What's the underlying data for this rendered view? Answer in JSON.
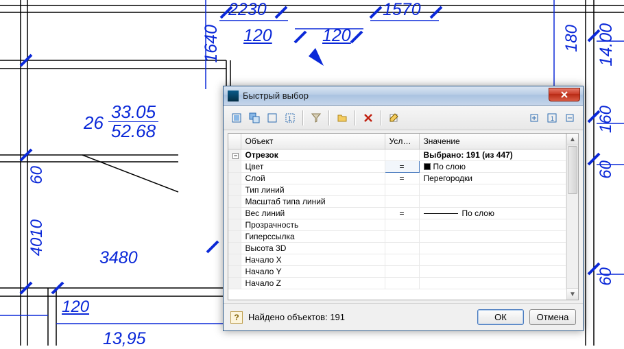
{
  "dialog": {
    "title": "Быстрый выбор",
    "columns": {
      "object": "Объект",
      "cond": "Услов...",
      "value": "Значение"
    },
    "group": {
      "name": "Отрезок",
      "summary": "Выбрано: 191 (из 447)"
    },
    "rows": [
      {
        "prop": "Цвет",
        "cond": "=",
        "value": "По слою",
        "swatch": true
      },
      {
        "prop": "Слой",
        "cond": "=",
        "value": "Перегородки"
      },
      {
        "prop": "Тип линий",
        "cond": "",
        "value": ""
      },
      {
        "prop": "Масштаб типа линий",
        "cond": "",
        "value": ""
      },
      {
        "prop": "Вес линий",
        "cond": "=",
        "value": "По слою",
        "line": true
      },
      {
        "prop": "Прозрачность",
        "cond": "",
        "value": ""
      },
      {
        "prop": "Гиперссылка",
        "cond": "",
        "value": ""
      },
      {
        "prop": "Высота 3D",
        "cond": "",
        "value": ""
      },
      {
        "prop": "Начало X",
        "cond": "",
        "value": ""
      },
      {
        "prop": "Начало Y",
        "cond": "",
        "value": ""
      },
      {
        "prop": "Начало Z",
        "cond": "",
        "value": ""
      }
    ],
    "status": "Найдено объектов: 191",
    "ok": "ОК",
    "cancel": "Отмена"
  },
  "cad": {
    "dims": {
      "d2230": "2230",
      "d1570": "1570",
      "d120a": "120",
      "d120b": "120",
      "d1640": "1640",
      "d26": "26",
      "d3305": "33.05",
      "d5268": "52.68",
      "d60a": "60",
      "d4010": "4010",
      "d3480": "3480",
      "d120c": "120",
      "d1395": "13,95",
      "d180": "180",
      "d1400": "14.00",
      "d160": "160",
      "d60b": "60",
      "d60c": "60"
    }
  }
}
